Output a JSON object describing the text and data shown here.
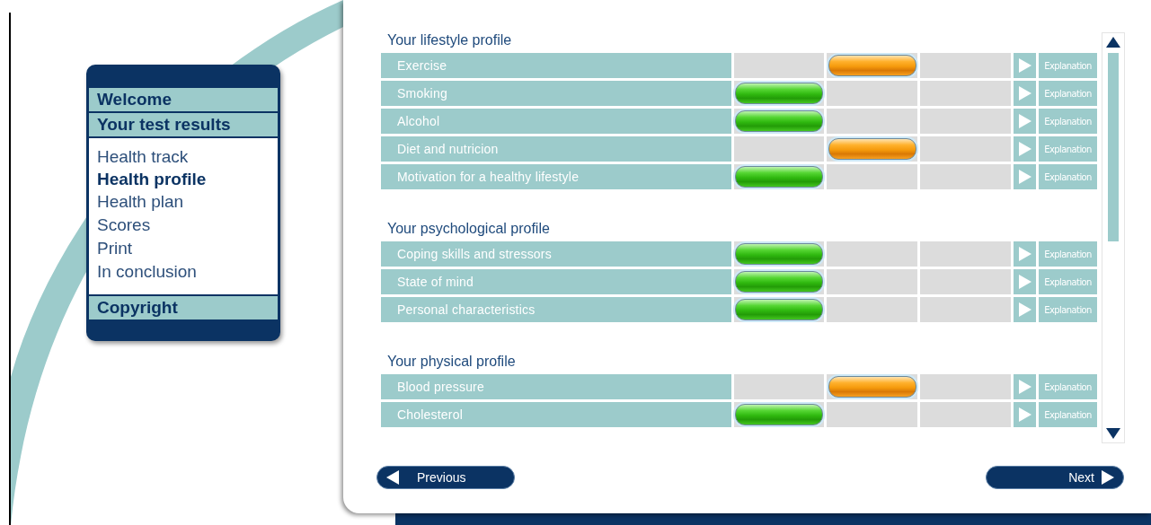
{
  "menu": {
    "sections": [
      {
        "label": "Welcome"
      },
      {
        "label": "Your test results",
        "items": [
          {
            "label": "Health track",
            "selected": false
          },
          {
            "label": "Health profile",
            "selected": true
          },
          {
            "label": "Health plan",
            "selected": false
          },
          {
            "label": "Scores",
            "selected": false
          },
          {
            "label": "Print",
            "selected": false
          },
          {
            "label": "In conclusion",
            "selected": false
          }
        ]
      },
      {
        "label": "Copyright"
      }
    ]
  },
  "profiles": [
    {
      "title": "Your lifestyle profile",
      "rows": [
        {
          "label": "Exercise",
          "kind": "moderate",
          "link": "Explanation"
        },
        {
          "label": "Smoking",
          "kind": "good",
          "link": "Explanation"
        },
        {
          "label": "Alcohol",
          "kind": "good",
          "link": "Explanation"
        },
        {
          "label": "Diet and nutricion",
          "kind": "moderate",
          "link": "Explanation"
        },
        {
          "label": "Motivation for a healthy lifestyle",
          "kind": "good",
          "link": "Explanation"
        }
      ]
    },
    {
      "title": "Your psychological profile",
      "rows": [
        {
          "label": "Coping skills and stressors",
          "kind": "good",
          "link": "Explanation"
        },
        {
          "label": "State of mind",
          "kind": "good",
          "link": "Explanation"
        },
        {
          "label": "Personal characteristics",
          "kind": "good",
          "link": "Explanation"
        }
      ]
    },
    {
      "title": "Your physical profile",
      "rows": [
        {
          "label": "Blood pressure",
          "kind": "moderate",
          "link": "Explanation"
        },
        {
          "label": "Cholesterol",
          "kind": "good",
          "link": "Explanation"
        }
      ]
    }
  ],
  "buttons": {
    "previous": "Previous",
    "next": "Next"
  }
}
